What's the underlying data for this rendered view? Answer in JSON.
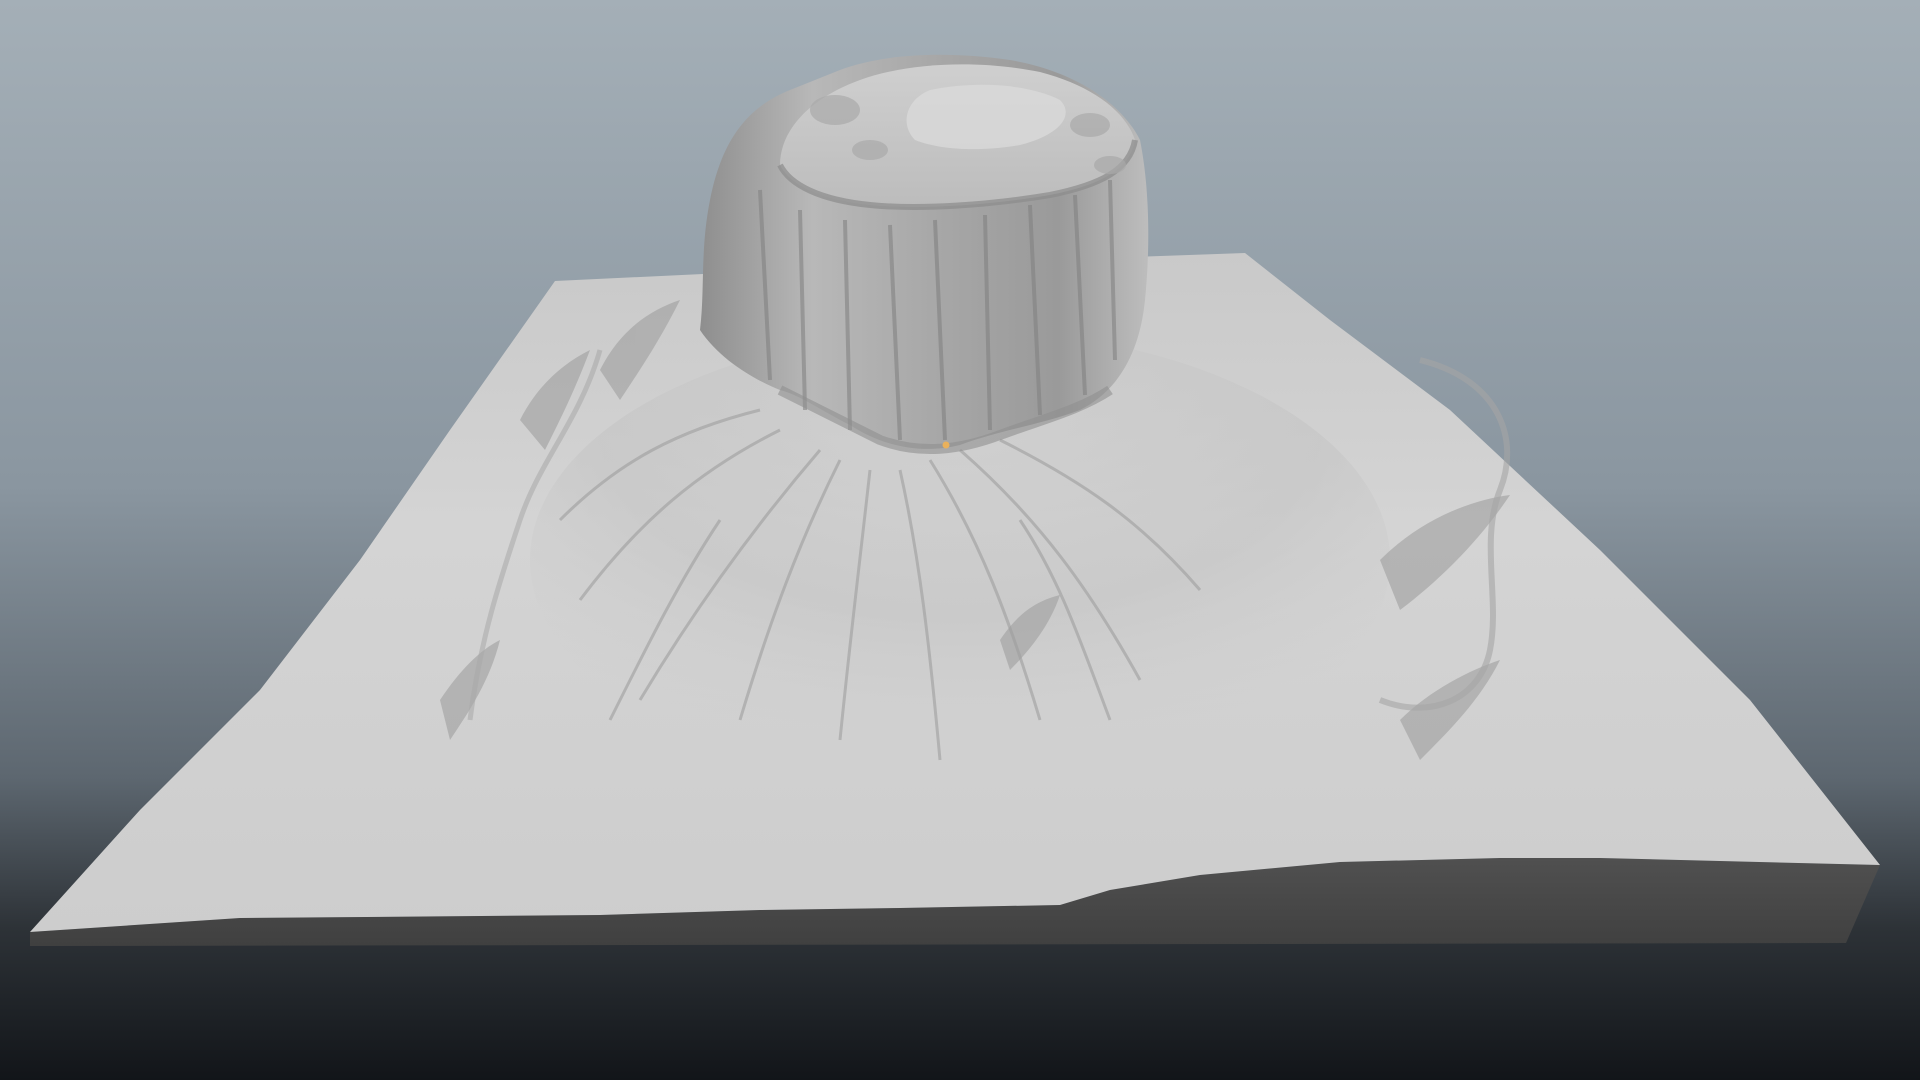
{
  "scene": {
    "subject": "terrain-butte",
    "colors": {
      "sky_top": "#a3aeb6",
      "sky_mid": "#7e8a94",
      "floor_dark": "#121519",
      "terrain_light": "#d2d2d2",
      "terrain_mid": "#b4b4b4",
      "terrain_shadow": "#8a8a8a",
      "side_face": "#4a4a4a",
      "pivot_marker": "#e9b15c"
    }
  }
}
